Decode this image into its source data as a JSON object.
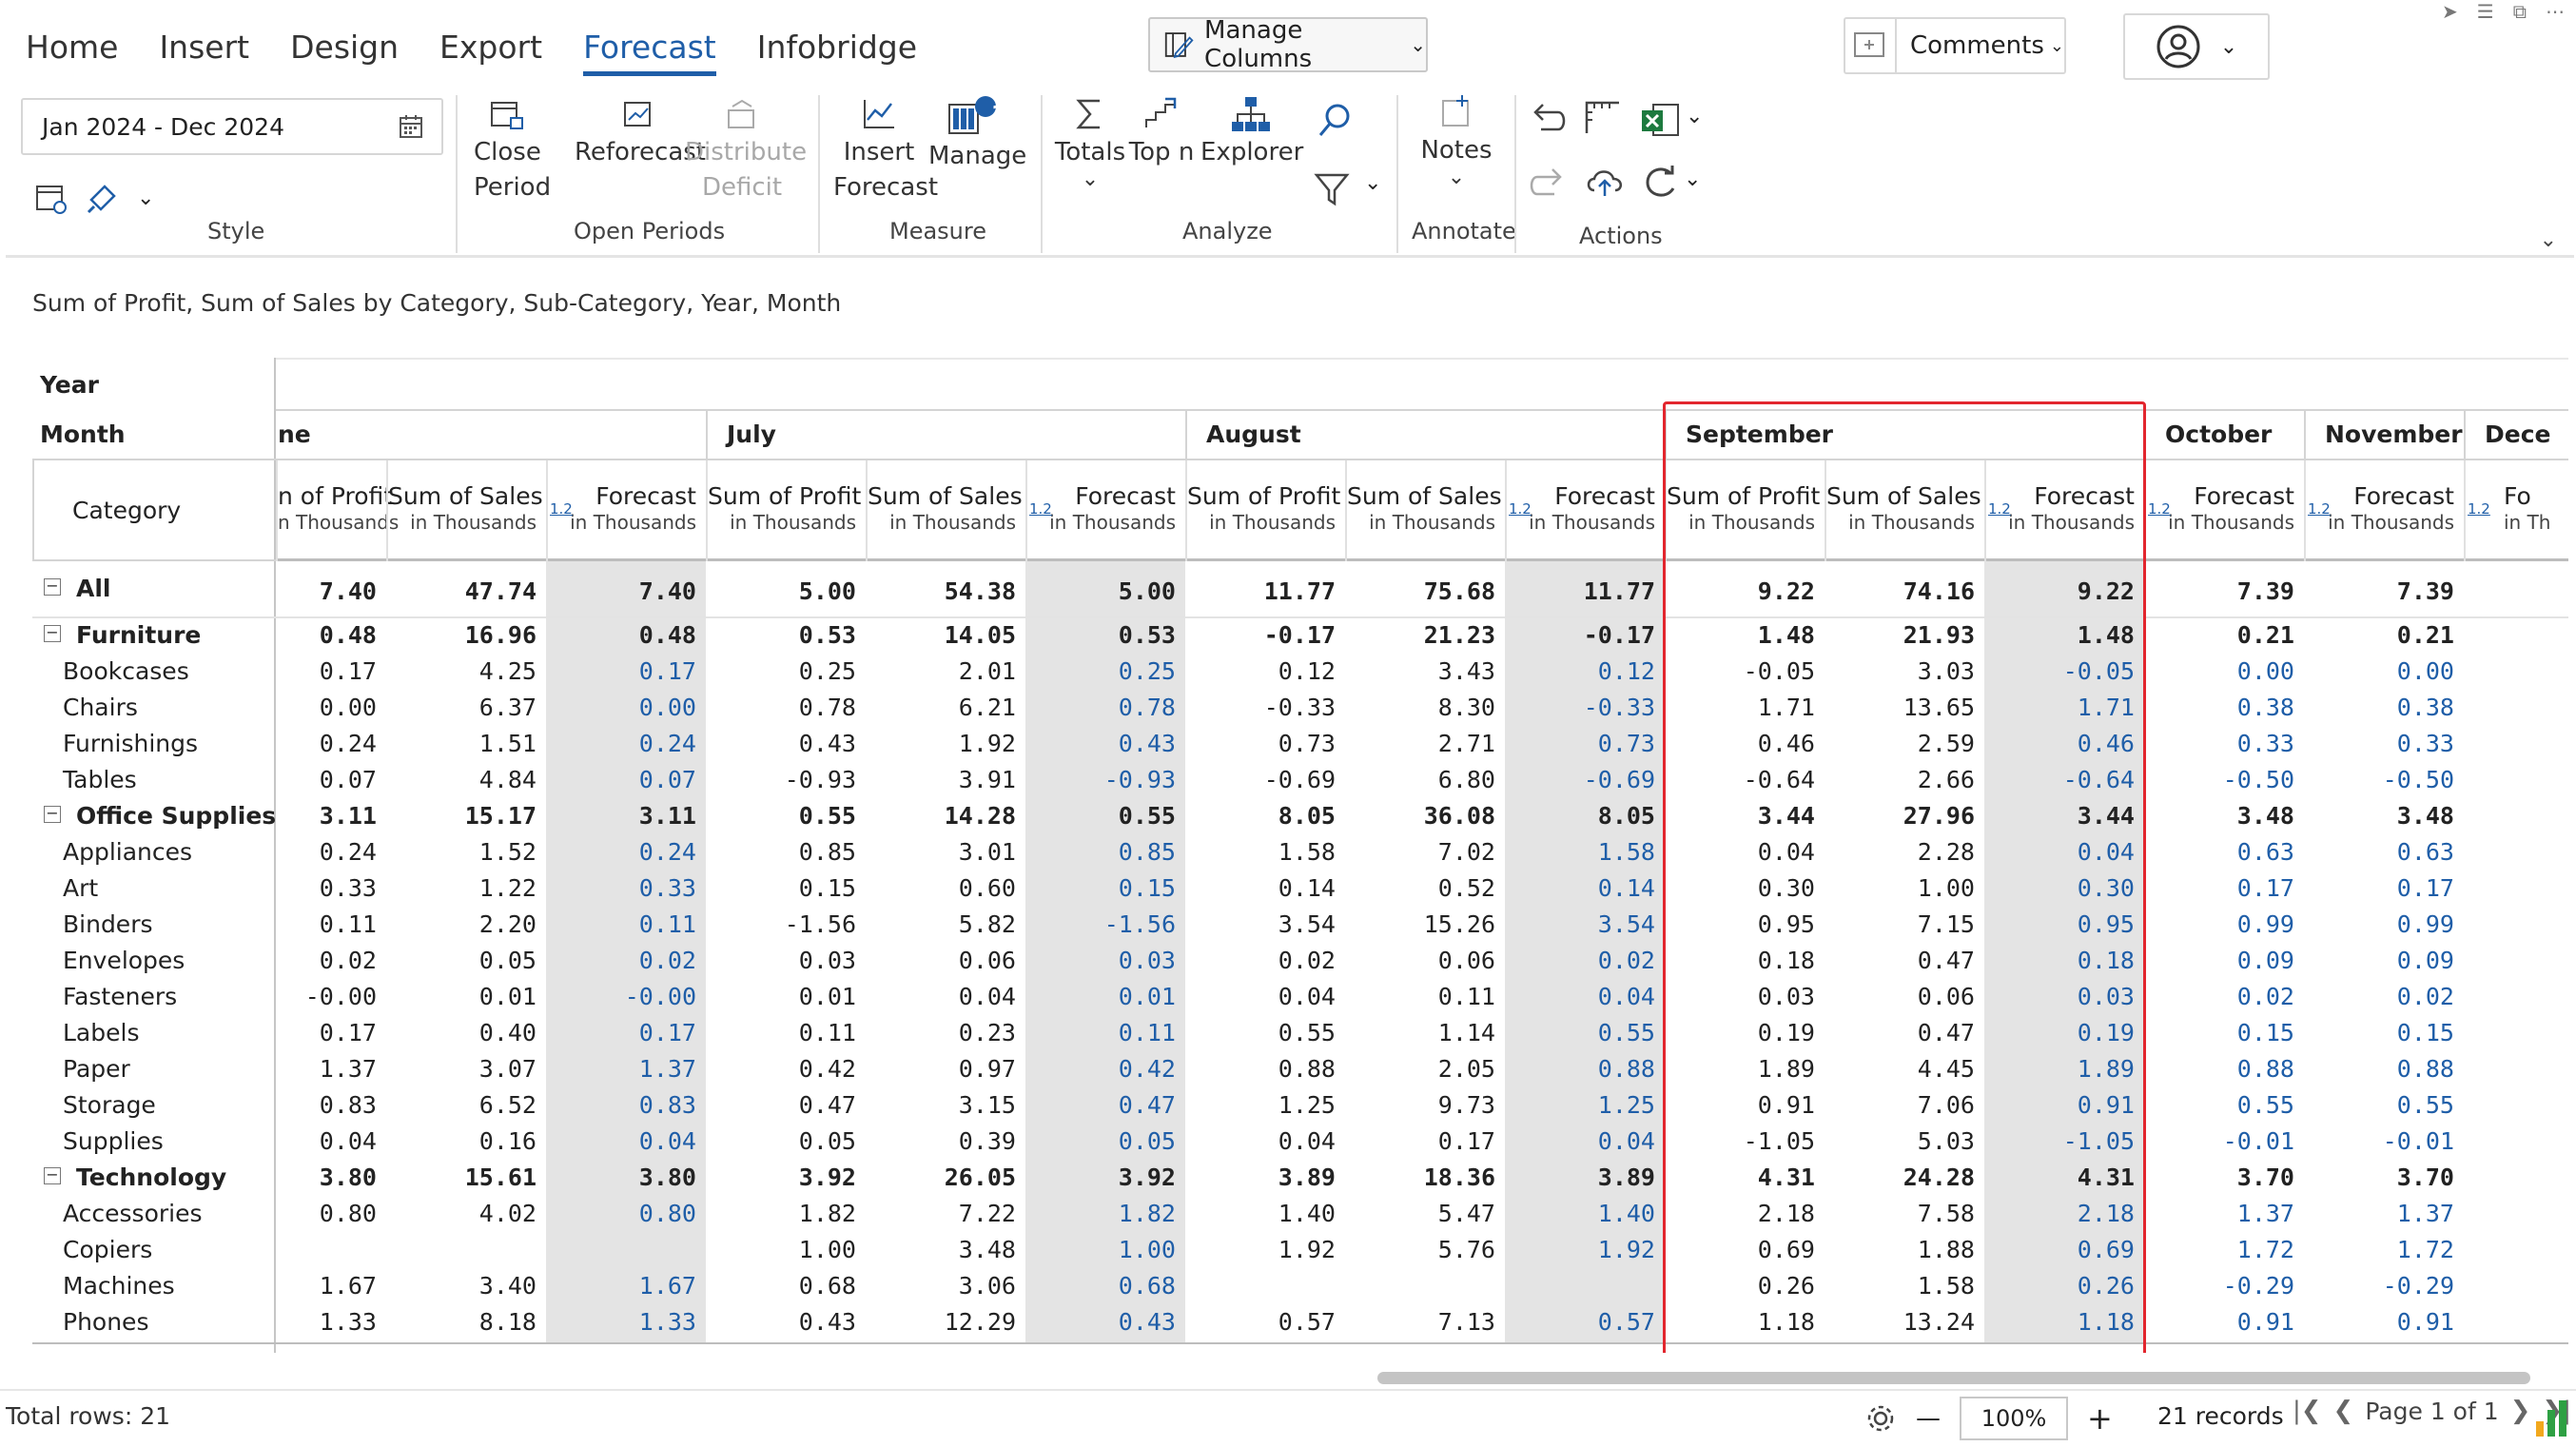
{
  "menu": {
    "tabs": [
      {
        "label": "Home"
      },
      {
        "label": "Insert"
      },
      {
        "label": "Design"
      },
      {
        "label": "Export"
      },
      {
        "label": "Forecast"
      },
      {
        "label": "Infobridge"
      }
    ],
    "active_tab": "Forecast"
  },
  "toolbar": {
    "manage_columns_label": "Manage Columns",
    "comments_label": "Comments",
    "date_range": "Jan 2024 - Dec 2024",
    "manage_badge": "1",
    "groups": {
      "style": "Style",
      "open_periods": "Open Periods",
      "measure": "Measure",
      "analyze": "Analyze",
      "annotate": "Annotate",
      "actions": "Actions"
    },
    "buttons": {
      "close_period_1": "Close",
      "close_period_2": "Period",
      "reforecast": "Reforecast",
      "distribute_1": "Distribute",
      "distribute_2": "Deficit",
      "insert_forecast_1": "Insert",
      "insert_forecast_2": "Forecast",
      "manage": "Manage",
      "totals": "Totals",
      "top_n": "Top n",
      "explorer": "Explorer",
      "notes": "Notes"
    }
  },
  "subtitle": "Sum of Profit, Sum of Sales by Category, Sub-Category, Year, Month",
  "grid": {
    "year_label": "Year",
    "month_label": "Month",
    "category_label": "Category",
    "months": [
      "ne",
      "July",
      "August",
      "September",
      "October",
      "November",
      "Dece"
    ],
    "col_headers": {
      "profit_1": "Sum of Profit",
      "profit_1_cut": "n of Profit",
      "sales_1": "Sum of Sales",
      "forecast_1": "Forecast",
      "forecast_1_cut": "Fo",
      "unit": "in Thousands",
      "unit_cut_left": "n Thousands",
      "unit_cut_right": "in Th",
      "badge": "1.2"
    },
    "rows": [
      {
        "cat": "All",
        "level": 0,
        "bold": true,
        "toggle": "⊟",
        "v": [
          "7.40",
          "47.74",
          "7.40",
          "5.00",
          "54.38",
          "5.00",
          "11.77",
          "75.68",
          "11.77",
          "9.22",
          "74.16",
          "9.22",
          "7.39",
          "7.39"
        ]
      },
      {
        "cat": "Furniture",
        "level": 1,
        "bold": true,
        "toggle": "⊟",
        "v": [
          "0.48",
          "16.96",
          "0.48",
          "0.53",
          "14.05",
          "0.53",
          "-0.17",
          "21.23",
          "-0.17",
          "1.48",
          "21.93",
          "1.48",
          "0.21",
          "0.21"
        ]
      },
      {
        "cat": "Bookcases",
        "level": 2,
        "v": [
          "0.17",
          "4.25",
          "0.17",
          "0.25",
          "2.01",
          "0.25",
          "0.12",
          "3.43",
          "0.12",
          "-0.05",
          "3.03",
          "-0.05",
          "0.00",
          "0.00"
        ]
      },
      {
        "cat": "Chairs",
        "level": 2,
        "v": [
          "0.00",
          "6.37",
          "0.00",
          "0.78",
          "6.21",
          "0.78",
          "-0.33",
          "8.30",
          "-0.33",
          "1.71",
          "13.65",
          "1.71",
          "0.38",
          "0.38"
        ]
      },
      {
        "cat": "Furnishings",
        "level": 2,
        "v": [
          "0.24",
          "1.51",
          "0.24",
          "0.43",
          "1.92",
          "0.43",
          "0.73",
          "2.71",
          "0.73",
          "0.46",
          "2.59",
          "0.46",
          "0.33",
          "0.33"
        ]
      },
      {
        "cat": "Tables",
        "level": 2,
        "v": [
          "0.07",
          "4.84",
          "0.07",
          "-0.93",
          "3.91",
          "-0.93",
          "-0.69",
          "6.80",
          "-0.69",
          "-0.64",
          "2.66",
          "-0.64",
          "-0.50",
          "-0.50"
        ]
      },
      {
        "cat": "Office Supplies",
        "level": 1,
        "bold": true,
        "toggle": "⊟",
        "v": [
          "3.11",
          "15.17",
          "3.11",
          "0.55",
          "14.28",
          "0.55",
          "8.05",
          "36.08",
          "8.05",
          "3.44",
          "27.96",
          "3.44",
          "3.48",
          "3.48"
        ]
      },
      {
        "cat": "Appliances",
        "level": 2,
        "v": [
          "0.24",
          "1.52",
          "0.24",
          "0.85",
          "3.01",
          "0.85",
          "1.58",
          "7.02",
          "1.58",
          "0.04",
          "2.28",
          "0.04",
          "0.63",
          "0.63"
        ]
      },
      {
        "cat": "Art",
        "level": 2,
        "v": [
          "0.33",
          "1.22",
          "0.33",
          "0.15",
          "0.60",
          "0.15",
          "0.14",
          "0.52",
          "0.14",
          "0.30",
          "1.00",
          "0.30",
          "0.17",
          "0.17"
        ]
      },
      {
        "cat": "Binders",
        "level": 2,
        "v": [
          "0.11",
          "2.20",
          "0.11",
          "-1.56",
          "5.82",
          "-1.56",
          "3.54",
          "15.26",
          "3.54",
          "0.95",
          "7.15",
          "0.95",
          "0.99",
          "0.99"
        ]
      },
      {
        "cat": "Envelopes",
        "level": 2,
        "v": [
          "0.02",
          "0.05",
          "0.02",
          "0.03",
          "0.06",
          "0.03",
          "0.02",
          "0.06",
          "0.02",
          "0.18",
          "0.47",
          "0.18",
          "0.09",
          "0.09"
        ]
      },
      {
        "cat": "Fasteners",
        "level": 2,
        "v": [
          "-0.00",
          "0.01",
          "-0.00",
          "0.01",
          "0.04",
          "0.01",
          "0.04",
          "0.11",
          "0.04",
          "0.03",
          "0.06",
          "0.03",
          "0.02",
          "0.02"
        ]
      },
      {
        "cat": "Labels",
        "level": 2,
        "v": [
          "0.17",
          "0.40",
          "0.17",
          "0.11",
          "0.23",
          "0.11",
          "0.55",
          "1.14",
          "0.55",
          "0.19",
          "0.47",
          "0.19",
          "0.15",
          "0.15"
        ]
      },
      {
        "cat": "Paper",
        "level": 2,
        "v": [
          "1.37",
          "3.07",
          "1.37",
          "0.42",
          "0.97",
          "0.42",
          "0.88",
          "2.05",
          "0.88",
          "1.89",
          "4.45",
          "1.89",
          "0.88",
          "0.88"
        ]
      },
      {
        "cat": "Storage",
        "level": 2,
        "v": [
          "0.83",
          "6.52",
          "0.83",
          "0.47",
          "3.15",
          "0.47",
          "1.25",
          "9.73",
          "1.25",
          "0.91",
          "7.06",
          "0.91",
          "0.55",
          "0.55"
        ]
      },
      {
        "cat": "Supplies",
        "level": 2,
        "v": [
          "0.04",
          "0.16",
          "0.04",
          "0.05",
          "0.39",
          "0.05",
          "0.04",
          "0.17",
          "0.04",
          "-1.05",
          "5.03",
          "-1.05",
          "-0.01",
          "-0.01"
        ]
      },
      {
        "cat": "Technology",
        "level": 1,
        "bold": true,
        "toggle": "⊟",
        "v": [
          "3.80",
          "15.61",
          "3.80",
          "3.92",
          "26.05",
          "3.92",
          "3.89",
          "18.36",
          "3.89",
          "4.31",
          "24.28",
          "4.31",
          "3.70",
          "3.70"
        ]
      },
      {
        "cat": "Accessories",
        "level": 2,
        "v": [
          "0.80",
          "4.02",
          "0.80",
          "1.82",
          "7.22",
          "1.82",
          "1.40",
          "5.47",
          "1.40",
          "2.18",
          "7.58",
          "2.18",
          "1.37",
          "1.37"
        ]
      },
      {
        "cat": "Copiers",
        "level": 2,
        "v": [
          "",
          "",
          "",
          "1.00",
          "3.48",
          "1.00",
          "1.92",
          "5.76",
          "1.92",
          "0.69",
          "1.88",
          "0.69",
          "1.72",
          "1.72"
        ]
      },
      {
        "cat": "Machines",
        "level": 2,
        "v": [
          "1.67",
          "3.40",
          "1.67",
          "0.68",
          "3.06",
          "0.68",
          "",
          "",
          "",
          "0.26",
          "1.58",
          "0.26",
          "-0.29",
          "-0.29"
        ]
      },
      {
        "cat": "Phones",
        "level": 2,
        "v": [
          "1.33",
          "8.18",
          "1.33",
          "0.43",
          "12.29",
          "0.43",
          "0.57",
          "7.13",
          "0.57",
          "1.18",
          "13.24",
          "1.18",
          "0.91",
          "0.91"
        ]
      }
    ]
  },
  "status": {
    "total_rows": "Total rows: 21",
    "zoom": "100%",
    "records": "21 records",
    "page": "Page 1 of 1"
  },
  "colors": {
    "accent": "#1f5ea8",
    "selection": "#e2262e",
    "forecast_shade": "#e4e4e4"
  }
}
